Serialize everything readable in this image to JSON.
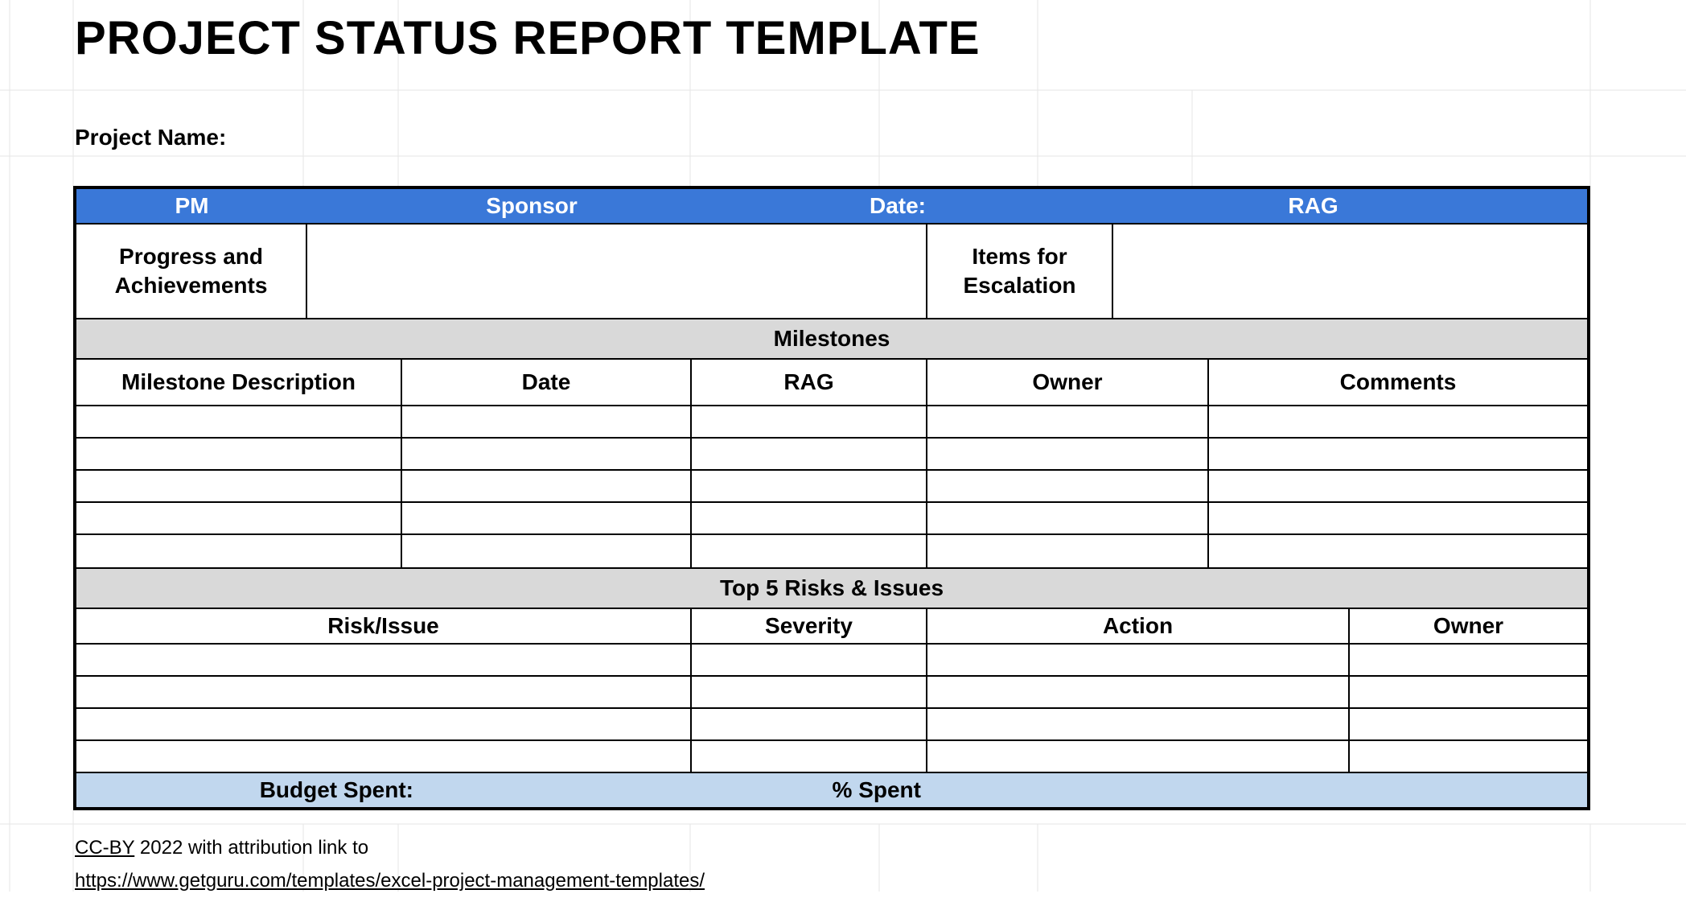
{
  "title": "PROJECT STATUS REPORT TEMPLATE",
  "project_name_label": "Project  Name:",
  "blue_header": {
    "pm": "PM",
    "sponsor": "Sponsor",
    "date": "Date:",
    "rag": "RAG"
  },
  "progress": {
    "progress_label": "Progress and Achievements",
    "progress_value": "",
    "escalation_label": "Items for Escalation",
    "escalation_value": ""
  },
  "milestones": {
    "banner": "Milestones",
    "headers": {
      "description": "Milestone Description",
      "date": "Date",
      "rag": "RAG",
      "owner": "Owner",
      "comments": "Comments"
    },
    "rows": [
      {
        "description": "",
        "date": "",
        "rag": "",
        "owner": "",
        "comments": ""
      },
      {
        "description": "",
        "date": "",
        "rag": "",
        "owner": "",
        "comments": ""
      },
      {
        "description": "",
        "date": "",
        "rag": "",
        "owner": "",
        "comments": ""
      },
      {
        "description": "",
        "date": "",
        "rag": "",
        "owner": "",
        "comments": ""
      },
      {
        "description": "",
        "date": "",
        "rag": "",
        "owner": "",
        "comments": ""
      }
    ]
  },
  "risks": {
    "banner": "Top 5 Risks & Issues",
    "headers": {
      "issue": "Risk/Issue",
      "severity": "Severity",
      "action": "Action",
      "owner": "Owner"
    },
    "rows": [
      {
        "issue": "",
        "severity": "",
        "action": "",
        "owner": ""
      },
      {
        "issue": "",
        "severity": "",
        "action": "",
        "owner": ""
      },
      {
        "issue": "",
        "severity": "",
        "action": "",
        "owner": ""
      },
      {
        "issue": "",
        "severity": "",
        "action": "",
        "owner": ""
      }
    ]
  },
  "budget": {
    "spent_label": "Budget Spent:",
    "spent_value": "",
    "pct_label": "% Spent",
    "pct_value": ""
  },
  "attribution": {
    "ccby": "CC-BY",
    "rest": " 2022 with attribution link to",
    "url": "https://www.getguru.com/templates/excel-project-management-templates/"
  },
  "colors": {
    "header_blue": "#3a78d8",
    "section_grey": "#d9d9d9",
    "budget_blue": "#c1d7ee"
  }
}
